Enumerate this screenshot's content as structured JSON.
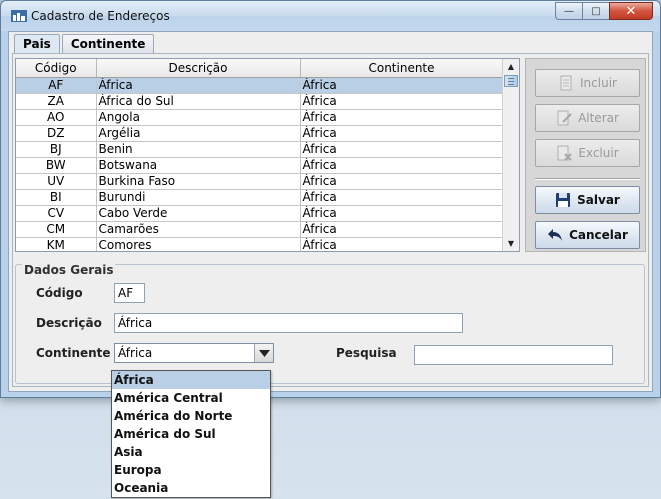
{
  "window": {
    "title": "Cadastro de Endereços",
    "buttons": {
      "minimize": "—",
      "maximize": "□",
      "close": "✕"
    }
  },
  "tabs": [
    {
      "label": "Pais",
      "active": true
    },
    {
      "label": "Continente",
      "active": false
    }
  ],
  "table": {
    "headers": [
      "Código",
      "Descrição",
      "Continente"
    ],
    "rows": [
      {
        "code": "AF",
        "desc": "África",
        "cont": "África",
        "selected": true
      },
      {
        "code": "ZA",
        "desc": "África do Sul",
        "cont": "África"
      },
      {
        "code": "AO",
        "desc": "Angola",
        "cont": "África"
      },
      {
        "code": "DZ",
        "desc": "Argélia",
        "cont": "África"
      },
      {
        "code": "BJ",
        "desc": "Benin",
        "cont": "África"
      },
      {
        "code": "BW",
        "desc": "Botswana",
        "cont": "África"
      },
      {
        "code": "UV",
        "desc": "Burkina Faso",
        "cont": "África"
      },
      {
        "code": "BI",
        "desc": "Burundi",
        "cont": "África"
      },
      {
        "code": "CV",
        "desc": "Cabo Verde",
        "cont": "África"
      },
      {
        "code": "CM",
        "desc": "Camarões",
        "cont": "África"
      },
      {
        "code": "KM",
        "desc": "Comores",
        "cont": "África"
      }
    ]
  },
  "actions": {
    "incluir": "Incluir",
    "alterar": "Alterar",
    "excluir": "Excluir",
    "salvar": "Salvar",
    "cancelar": "Cancelar"
  },
  "form": {
    "group_title": "Dados Gerais",
    "codigo_label": "Código",
    "codigo_value": "AF",
    "descricao_label": "Descrição",
    "descricao_value": "África",
    "continente_label": "Continente",
    "continente_value": "África",
    "pesquisa_label": "Pesquisa",
    "pesquisa_value": ""
  },
  "continente_options": [
    "África",
    "América Central",
    "América do Norte",
    "América do Sul",
    "Asia",
    "Europa",
    "Oceania"
  ],
  "colors": {
    "selection": "#b8cfe5",
    "titlebar": "#c7dbee",
    "close_button": "#c23a25"
  }
}
